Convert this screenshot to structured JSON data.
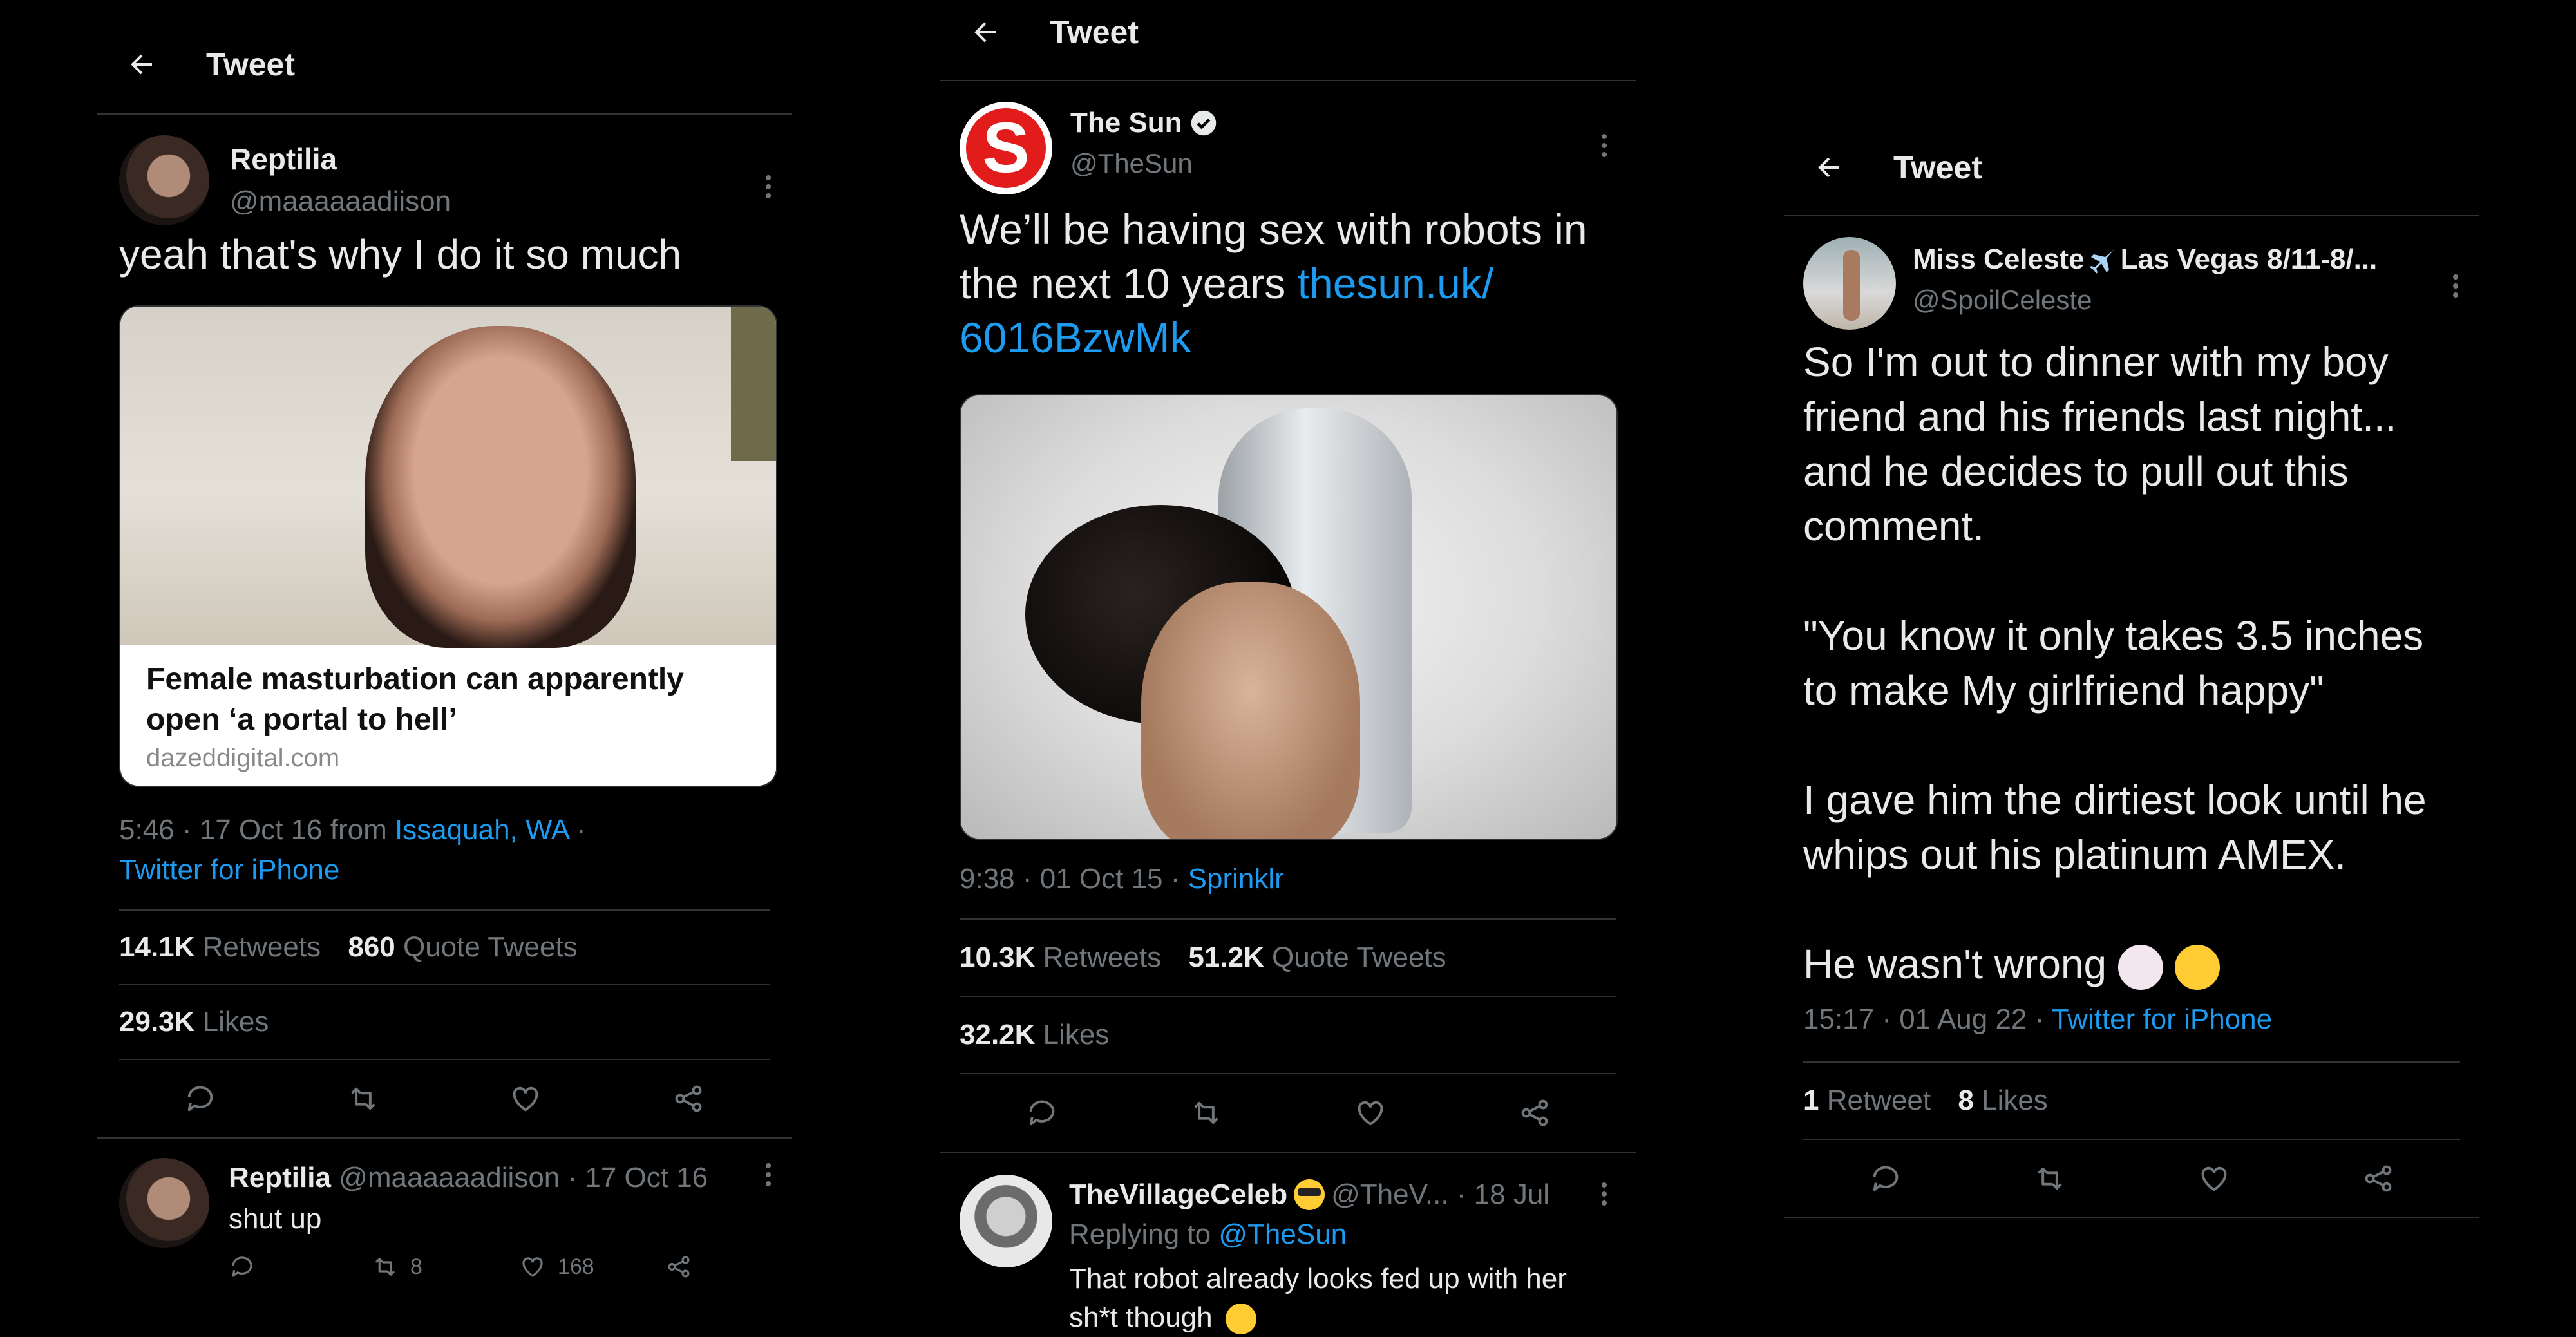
{
  "header": {
    "title": "Tweet"
  },
  "tweet1": {
    "author": {
      "name": "Reptilia",
      "handle": "@maaaaaadiison"
    },
    "text": "yeah that's why I do it so much",
    "card": {
      "title_line1": "Female masturbation can apparently",
      "title_line2": "open ‘a portal to hell’",
      "domain": "dazeddigital.com"
    },
    "meta": {
      "time": "5:46 · 17 Oct 16 from ",
      "location": "Issaquah, WA",
      "sep": " ·",
      "source": "Twitter for iPhone"
    },
    "stats": {
      "retweets": "14.1K",
      "retweets_label": "Retweets",
      "quotes": "860",
      "quotes_label": "Quote Tweets",
      "likes": "29.3K",
      "likes_label": "Likes"
    },
    "reply": {
      "name": "Reptilia",
      "handle_date": "@maaaaaadiison · 17 Oct 16",
      "text": "shut up",
      "retweets": "8",
      "likes": "168"
    }
  },
  "tweet2": {
    "author": {
      "name": "The Sun",
      "handle": "@TheSun"
    },
    "text_line1": "We’ll be having sex with robots in",
    "text_line2": "the next 10 years ",
    "link_line1": "thesun.uk/",
    "link_line2": "6016BzwMk",
    "meta": {
      "time": "9:38 · 01 Oct 15 · ",
      "source": "Sprinklr"
    },
    "stats": {
      "retweets": "10.3K",
      "retweets_label": "Retweets",
      "quotes": "51.2K",
      "quotes_label": "Quote Tweets",
      "likes": "32.2K",
      "likes_label": "Likes"
    },
    "reply": {
      "name": "TheVillageCeleb",
      "handle_date": "@TheV... · 18 Jul",
      "replying_prefix": "Replying to ",
      "replying_to": "@TheSun",
      "text_line1": "That robot already looks fed up with her",
      "text_line2": "sh*t though"
    }
  },
  "tweet3": {
    "author": {
      "name": "Miss Celeste",
      "name_suffix": " Las Vegas 8/11-8/...",
      "handle": "@SpoilCeleste"
    },
    "lines": [
      "So I'm out to dinner with my boy",
      "friend and his friends last night...",
      "and he decides to pull out this",
      "comment.",
      "\"You know it only takes 3.5 inches",
      "to make My girlfriend happy\"",
      "I gave him the dirtiest look until he",
      "whips out his platinum AMEX.",
      "He wasn't wrong "
    ],
    "meta": {
      "time": "15:17 · 01 Aug 22 · ",
      "source": "Twitter for iPhone"
    },
    "stats": {
      "retweets": "1",
      "retweets_label": "Retweet",
      "likes": "8",
      "likes_label": "Likes"
    }
  },
  "icons": [
    "back-arrow-icon",
    "reply-icon",
    "retweet-icon",
    "like-icon",
    "share-icon",
    "more-icon",
    "verified-icon",
    "airplane-icon"
  ]
}
